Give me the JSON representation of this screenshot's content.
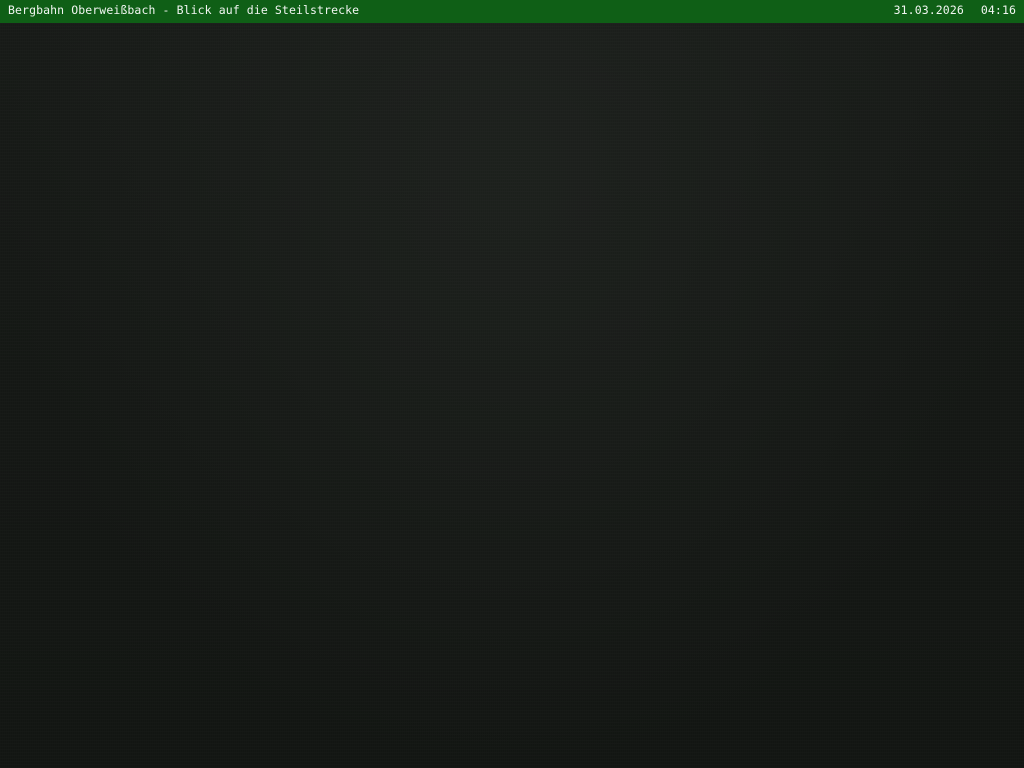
{
  "overlay": {
    "caption": "Bergbahn Oberweißbach - Blick auf die Steilstrecke",
    "date": "31.03.2026",
    "time": "04:16"
  },
  "colors": {
    "overlay_bar": "#0f5f16",
    "overlay_text": "#f2f6f2",
    "night_scene": "#141714"
  }
}
